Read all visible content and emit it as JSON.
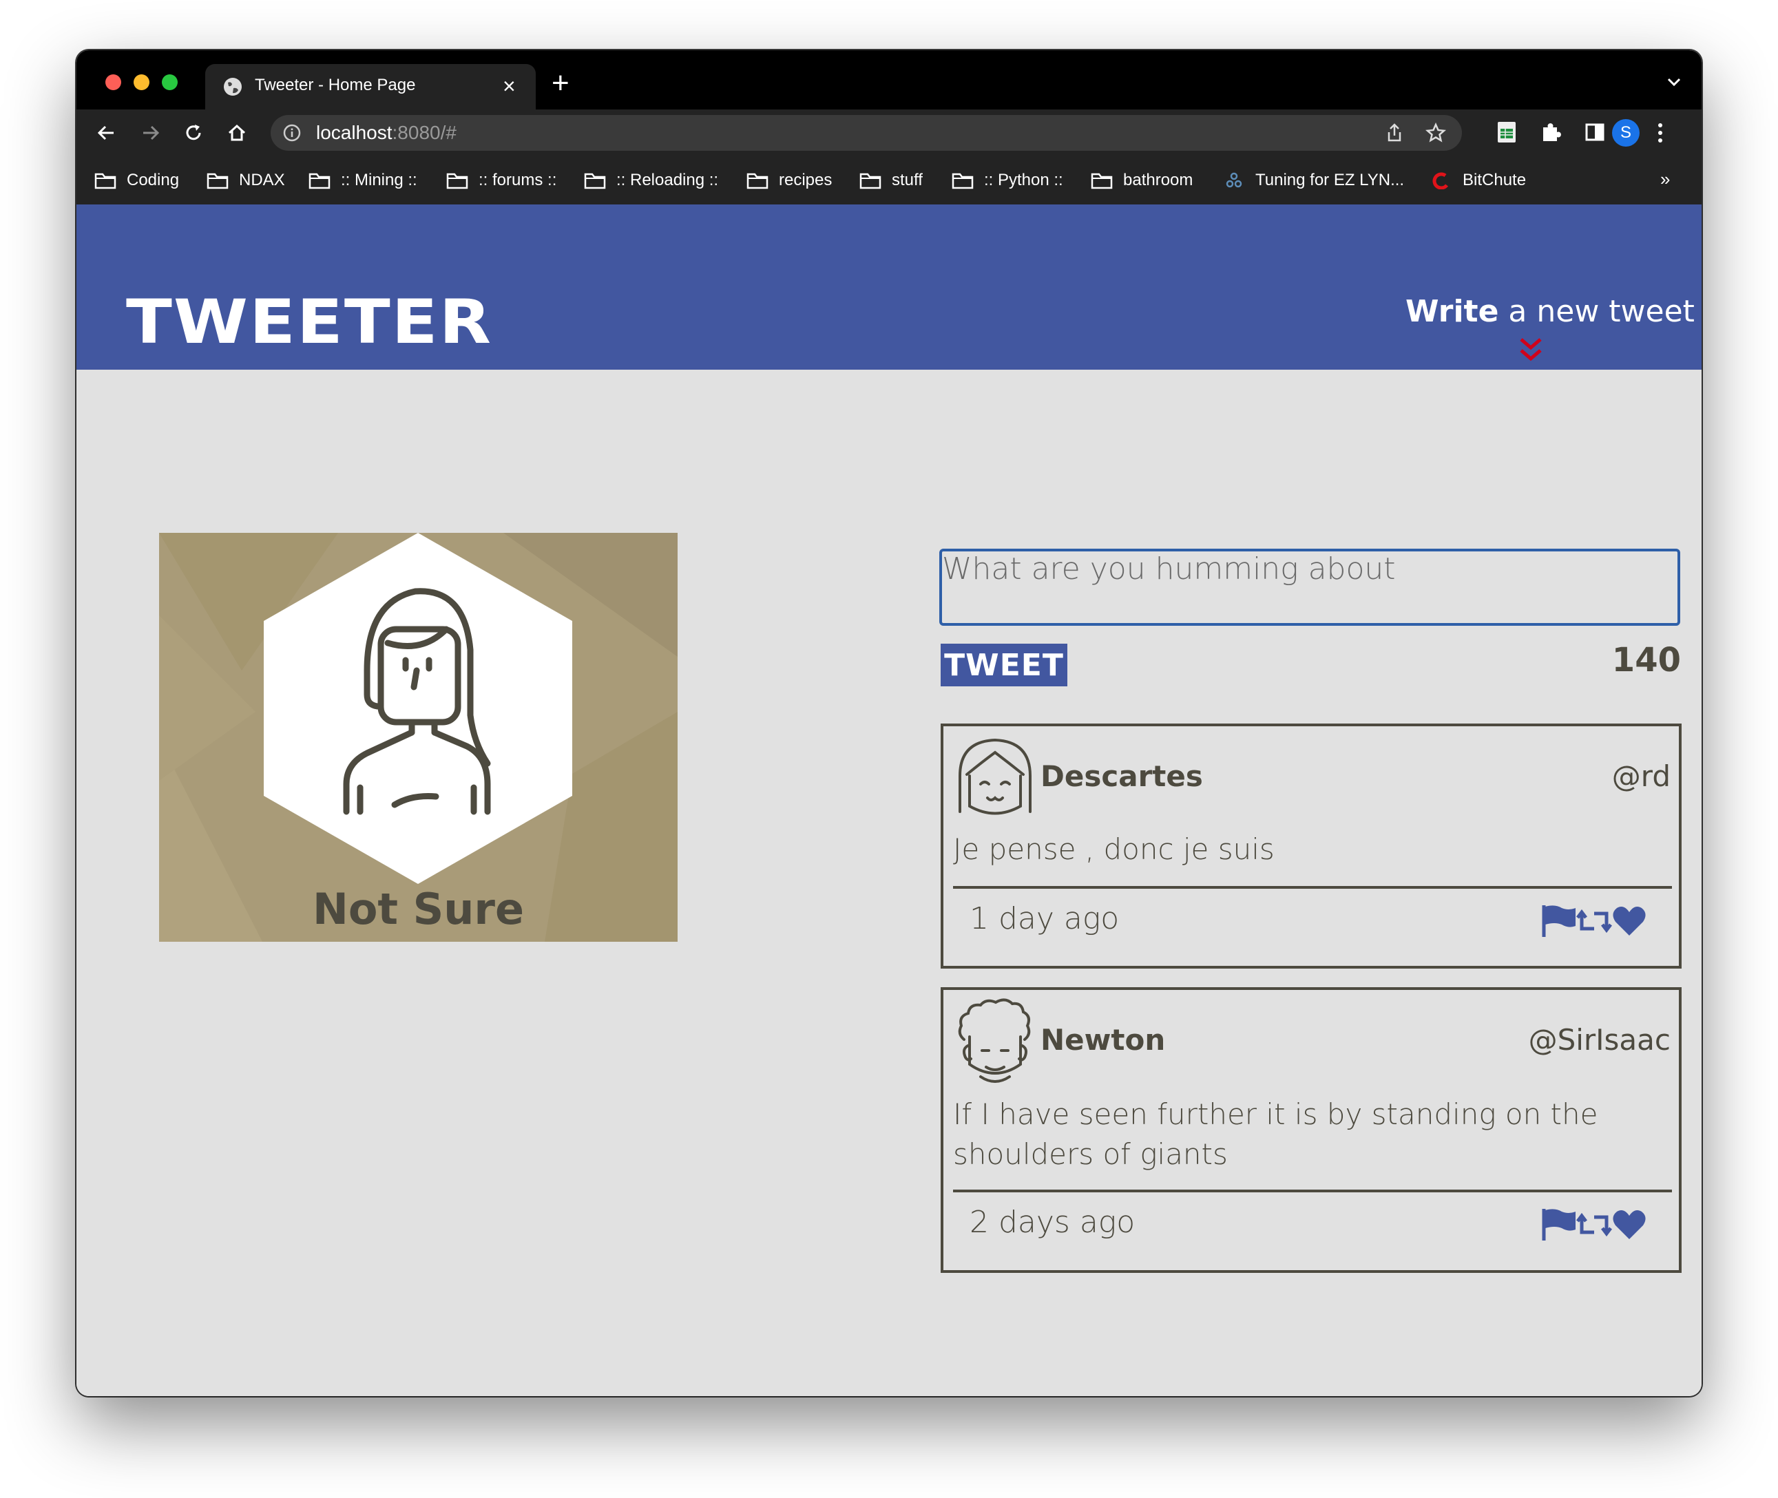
{
  "browser": {
    "tab_title": "Tweeter - Home Page",
    "url_host": "localhost",
    "url_rest": ":8080/#",
    "profile_initial": "S",
    "bookmarks": [
      {
        "label": "Coding",
        "icon": "folder-icon"
      },
      {
        "label": "NDAX",
        "icon": "folder-icon"
      },
      {
        "label": ":: Mining ::",
        "icon": "folder-icon"
      },
      {
        "label": ":: forums ::",
        "icon": "folder-icon"
      },
      {
        "label": ":: Reloading ::",
        "icon": "folder-icon"
      },
      {
        "label": "recipes",
        "icon": "folder-icon"
      },
      {
        "label": "stuff",
        "icon": "folder-icon"
      },
      {
        "label": ":: Python ::",
        "icon": "folder-icon"
      },
      {
        "label": "bathroom",
        "icon": "folder-icon"
      },
      {
        "label": "Tuning for EZ LYN...",
        "icon": "molecule-icon"
      },
      {
        "label": "BitChute",
        "icon": "bitchute-logo-icon"
      }
    ],
    "bookmarks_more": "»"
  },
  "header": {
    "logo": "TWEETER",
    "write_bold": "Write",
    "write_rest": " a new tweet",
    "write_icon": "double-chevron-down-icon"
  },
  "profile": {
    "name": "Not Sure",
    "avatar_icon": "woman-avatar-icon"
  },
  "composer": {
    "placeholder": "What are you humming about",
    "button_label": "TWEET",
    "counter": "140"
  },
  "tweets": [
    {
      "name": "Descartes",
      "handle": "@rd",
      "text": "Je pense , donc je suis",
      "time": "1 day ago",
      "avatar_icon": "girl-avatar-icon"
    },
    {
      "name": "Newton",
      "handle": "@SirIsaac",
      "text": "If I have seen further it is by standing on the shoulders of giants",
      "time": "2 days ago",
      "avatar_icon": "curly-hair-avatar-icon"
    }
  ],
  "colors": {
    "header_bg": "#4257a0",
    "page_bg": "#e1e1e1",
    "text": "#4d4a3f",
    "accent_red": "#d0021b",
    "icon_blue": "#4257a0",
    "card_bg": "#a99b78"
  }
}
